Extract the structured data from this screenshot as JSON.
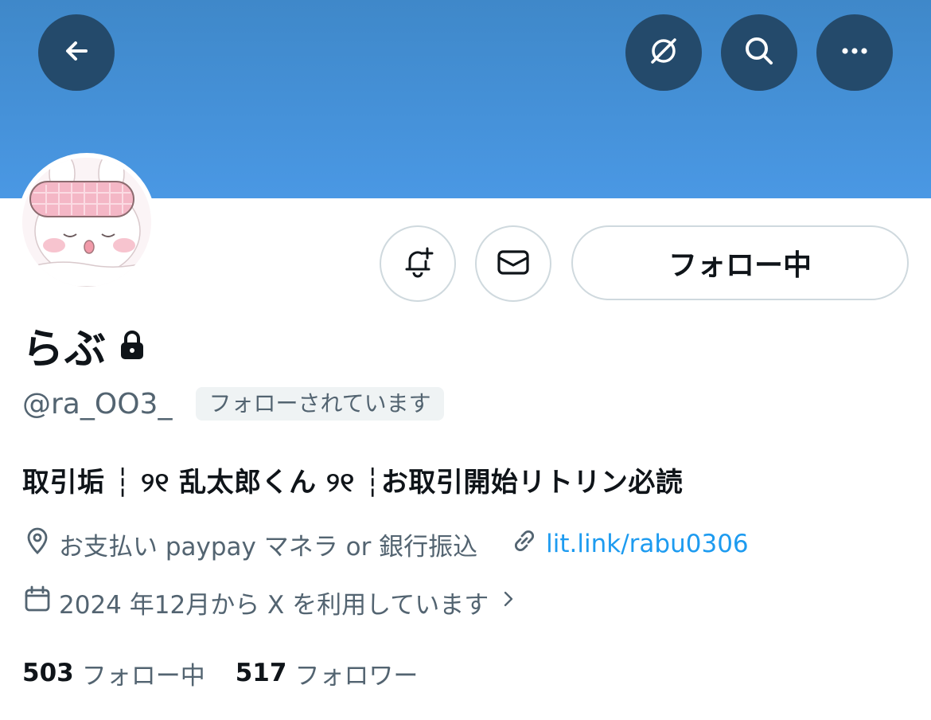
{
  "header": {
    "back_icon": "arrow-left-icon",
    "grok_icon": "grok-icon",
    "search_icon": "search-icon",
    "more_icon": "more-horizontal-icon",
    "banner_color": "#4a98e4",
    "button_color": "#244a6b"
  },
  "actions": {
    "notify_icon": "bell-plus-icon",
    "message_icon": "envelope-icon",
    "follow_label": "フォロー中"
  },
  "profile": {
    "display_name": "らぶ",
    "protected_icon": "lock-icon",
    "handle": "@ra_OO3_",
    "follows_you": "フォローされています",
    "bio": "取引垢 ┆ ୨୧ 乱太郎くん ୨୧ ┆お取引開始リトリン必読",
    "location": "お支払い paypay マネラ or 銀行振込",
    "website": "lit.link/rabu0306",
    "joined": "2024 年12月から X を利用しています"
  },
  "stats": {
    "following_count": "503",
    "following_label": "フォロー中",
    "followers_count": "517",
    "followers_label": "フォロワー"
  },
  "colors": {
    "text": "#0f1419",
    "secondary": "#536471",
    "link": "#1d9bf0",
    "border": "#cfd9de"
  }
}
